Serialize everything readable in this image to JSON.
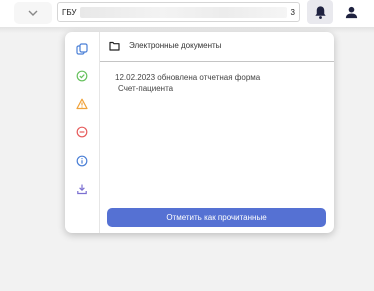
{
  "header": {
    "org_prefix": "ГБУ",
    "org_suffix": "3"
  },
  "notifications": {
    "category_title": "Электронные документы",
    "message_line1": "12.02.2023 обновлена отчетная форма",
    "message_line2": "Счет-пациента",
    "mark_read_label": "Отметить как прочитанные",
    "rail_icons": [
      {
        "name": "copy-icon",
        "color": "#4a7fd6"
      },
      {
        "name": "check-circle-icon",
        "color": "#67c25e"
      },
      {
        "name": "warning-icon",
        "color": "#f0a23a"
      },
      {
        "name": "minus-circle-icon",
        "color": "#e65b5b"
      },
      {
        "name": "info-icon",
        "color": "#4a7fd6"
      },
      {
        "name": "download-icon",
        "color": "#7b6fd1"
      }
    ]
  },
  "colors": {
    "accent": "#5571d3",
    "background": "#f2f2f2"
  }
}
